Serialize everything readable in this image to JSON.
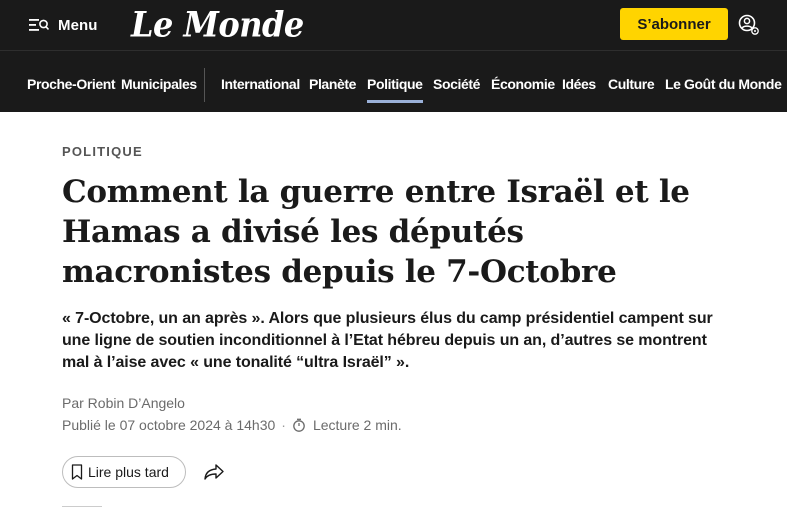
{
  "header": {
    "menu_label": "Menu",
    "logo_text": "Le Monde",
    "subscribe_label": "S’abonner",
    "icons": {
      "menu": "menu-search-icon",
      "account": "user-account-icon"
    },
    "colors": {
      "bar": "#1a1a1a",
      "subscribe": "#ffd400",
      "active_underline": "#9ab0d8"
    }
  },
  "nav": {
    "items": [
      {
        "label": "Proche-Orient"
      },
      {
        "label": "Municipales"
      },
      {
        "label": "International"
      },
      {
        "label": "Planète"
      },
      {
        "label": "Politique",
        "active": true
      },
      {
        "label": "Société"
      },
      {
        "label": "Économie"
      },
      {
        "label": "Idées"
      },
      {
        "label": "Culture"
      },
      {
        "label": "Le Goût du Monde"
      }
    ]
  },
  "article": {
    "section": "POLITIQUE",
    "title": "Comment la guerre entre Israël et le Hamas a divisé les députés macronistes depuis le 7-Octobre",
    "description": "« 7-Octobre, un an après ». Alors que plusieurs élus du camp présidentiel campent sur une ligne de soutien inconditionnel à l’Etat hébreu depuis un an, d’autres se montrent mal à l’aise avec « une tonalité “ultra Israël” ».",
    "author": "Par Robin D’Angelo",
    "published": "Publié le 07 octobre 2024 à 14h30",
    "separator": "·",
    "reading_time": "Lecture 2 min.",
    "read_later_label": "Lire plus tard",
    "icons": {
      "timer": "stopwatch-icon",
      "bookmark": "bookmark-icon",
      "share": "share-icon"
    }
  }
}
